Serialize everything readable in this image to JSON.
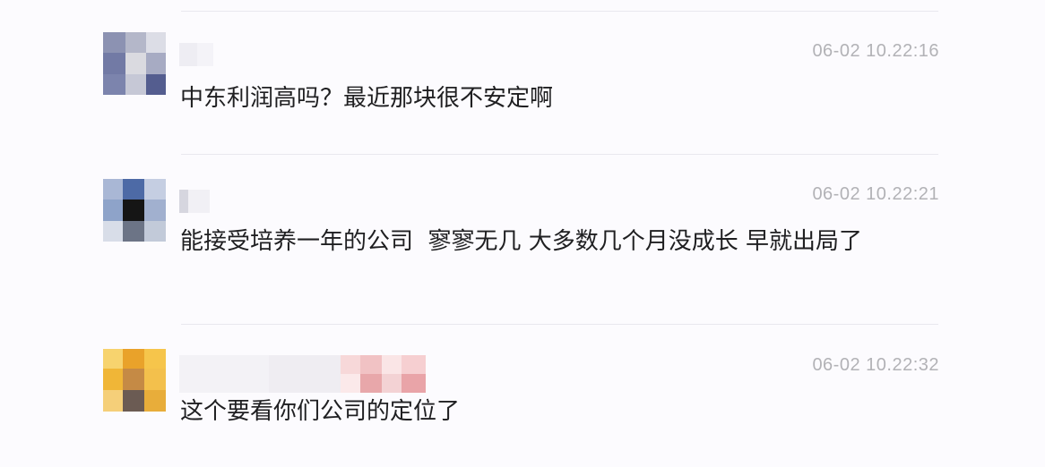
{
  "comments": [
    {
      "timestamp": "06-02 10.22:16",
      "text": "中东利润高吗？最近那块很不安定啊"
    },
    {
      "timestamp": "06-02 10.22:21",
      "text": "能接受培养一年的公司  寥寥无几 大多数几个月没成长 早就出局了"
    },
    {
      "timestamp": "06-02 10.22:32",
      "text": "这个要看你们公司的定位了"
    }
  ],
  "colors": {
    "background": "#fcfbfe",
    "divider": "#e9e8ee",
    "timestamp": "#b2b2b6",
    "text": "#1f1f21"
  }
}
